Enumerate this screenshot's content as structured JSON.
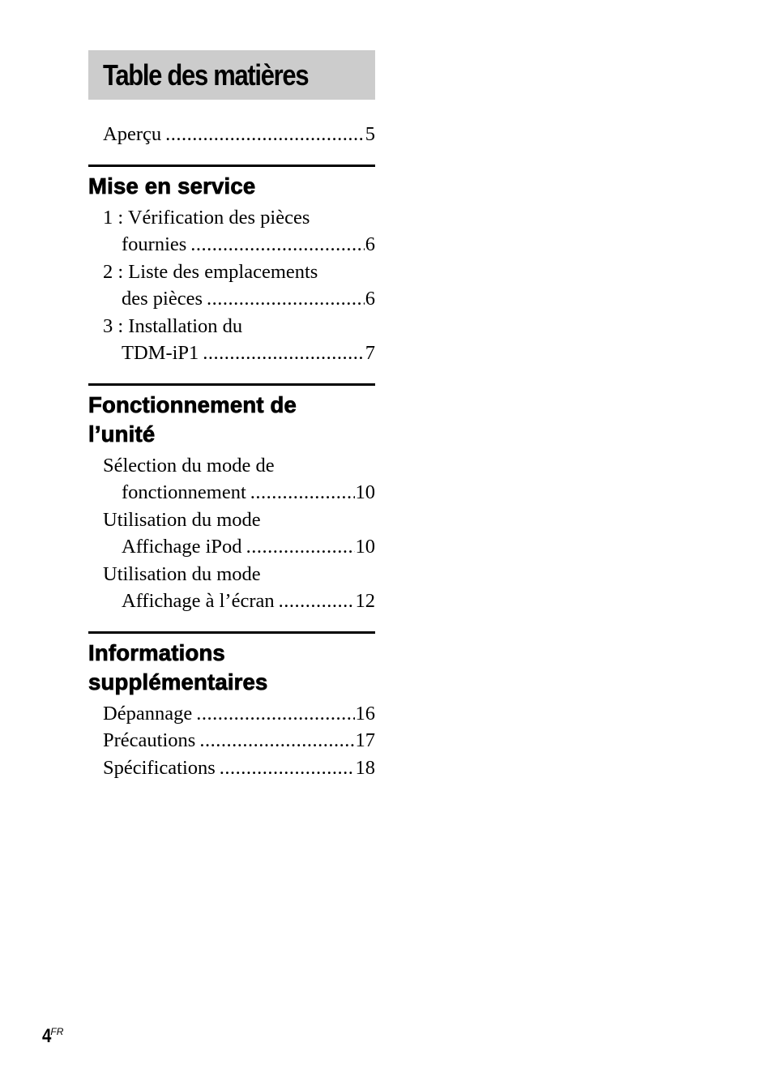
{
  "title": "Table des matières",
  "intro": {
    "label": "Aperçu",
    "page": "5"
  },
  "sections": [
    {
      "heading_lines": [
        "Mise en service"
      ],
      "entries": [
        {
          "line1": "1 : Vérification des pièces",
          "line2": "fournies",
          "page": "6"
        },
        {
          "line1": "2 : Liste des emplacements",
          "line2": "des pièces",
          "page": "6"
        },
        {
          "line1": "3 : Installation du",
          "line2": "TDM-iP1",
          "page": "7"
        }
      ]
    },
    {
      "heading_lines": [
        "Fonctionnement de",
        "l’unité"
      ],
      "entries": [
        {
          "line1": "Sélection du mode de",
          "line2": "fonctionnement",
          "page": "10"
        },
        {
          "line1": "Utilisation du mode",
          "line2": "Affichage iPod",
          "page": "10"
        },
        {
          "line1": "Utilisation du mode",
          "line2": "Affichage à l’écran",
          "page": "12"
        }
      ]
    },
    {
      "heading_lines": [
        "Informations",
        "supplémentaires"
      ],
      "entries": [
        {
          "label": "Dépannage",
          "page": "16"
        },
        {
          "label": "Précautions",
          "page": "17"
        },
        {
          "label": "Spécifications",
          "page": "18"
        }
      ]
    }
  ],
  "footer": {
    "page_number": "4",
    "language_code": "FR"
  }
}
